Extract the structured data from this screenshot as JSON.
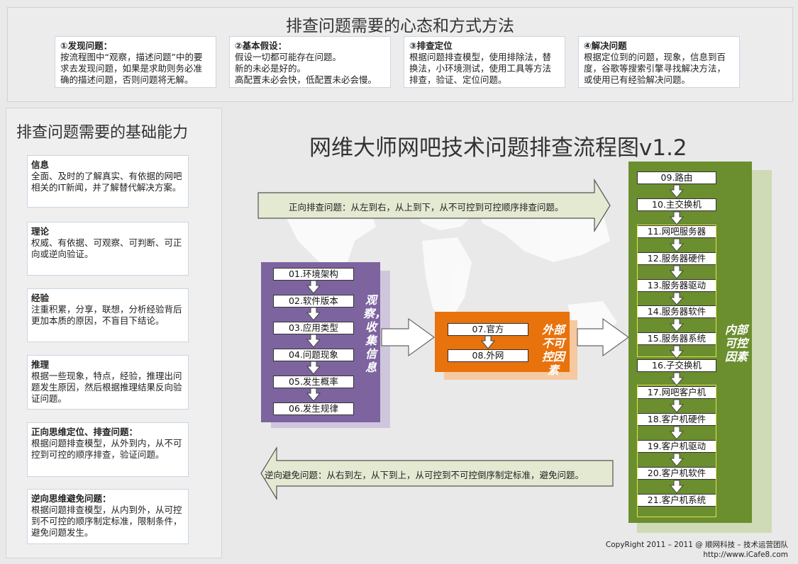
{
  "top": {
    "title": "排查问题需要的心态和方式方法",
    "boxes": [
      {
        "head": "①发现问题：",
        "body": "按流程图中“观察，描述问题”中的要求去发现问题，如果是求助则务必准确的描述问题，否则问题将无解。"
      },
      {
        "head": "②基本假设：",
        "body": "假设一切都可能存在问题。\n新的未必是好的。\n高配置未必会快，低配置未必会慢。"
      },
      {
        "head": "③排查定位",
        "body": "根据问题排查模型，使用排除法，替换法，小环境测试，使用工具等方法排查，验证、定位问题。"
      },
      {
        "head": "④解决问题",
        "body": "根据定位到的问题，现象，信息到百度，谷歌等搜索引擎寻找解决方法，或使用已有经验解决问题。"
      }
    ]
  },
  "abilities": {
    "title": "排查问题需要的基础能力",
    "items": [
      {
        "head": "信息",
        "body": "全面、及时的了解真实、有依据的网吧相关的IT新闻，并了解替代解决方案。"
      },
      {
        "head": "理论",
        "body": "权威、有依据、可观察、可判断、可正向或逆向验证。"
      },
      {
        "head": "经验",
        "body": "注重积累，分享，联想，分析经验背后更加本质的原因，不盲目下结论。"
      },
      {
        "head": "推理",
        "body": "根据一些现象，特点，经验，推理出问题发生原因，然后根据推理结果反向验证问题。"
      },
      {
        "head": "正向思维定位、排查问题：",
        "body": "根据问题排查模型，从外到内，从不可控到可控的顺序排查，验证问题。"
      },
      {
        "head": "逆向思维避免问题：",
        "body": "根据问题排查模型，从内到外，从可控到不可控的顺序制定标准，限制条件，避免问题发生。"
      }
    ]
  },
  "flow": {
    "title": "网维大师网吧技术问题排查流程图v1.2",
    "forward_text": "正向排查问题：从左到右，从上到下，从不可控到可控顺序排查问题。",
    "reverse_text": "逆向避免问题：从右到左，从下到上，从可控到不可控倒序制定标准，避免问题。",
    "observe": {
      "label": "观察，收集信息",
      "steps": [
        "01.环境架构",
        "02.软件版本",
        "03.应用类型",
        "04.问题现象",
        "05.发生概率",
        "06.发生规律"
      ]
    },
    "external": {
      "label": "外部不可控因素",
      "steps": [
        "07.官方",
        "08.外网"
      ]
    },
    "internal": {
      "label": "内部可控因素",
      "steps": [
        "09.路由",
        "10.主交换机",
        "11.网吧服务器",
        "12.服务器硬件",
        "13.服务器驱动",
        "14.服务器软件",
        "15.服务器系统",
        "16.子交换机",
        "17.网吧客户机",
        "18.客户机硬件",
        "19.客户机驱动",
        "20.客户机软件",
        "21.客户机系统"
      ]
    }
  },
  "footer": {
    "copyright": "CopyRight 2011 – 2011 @ 顺网科技 – 技术运营团队",
    "url": "http://www.iCafe8.com"
  }
}
